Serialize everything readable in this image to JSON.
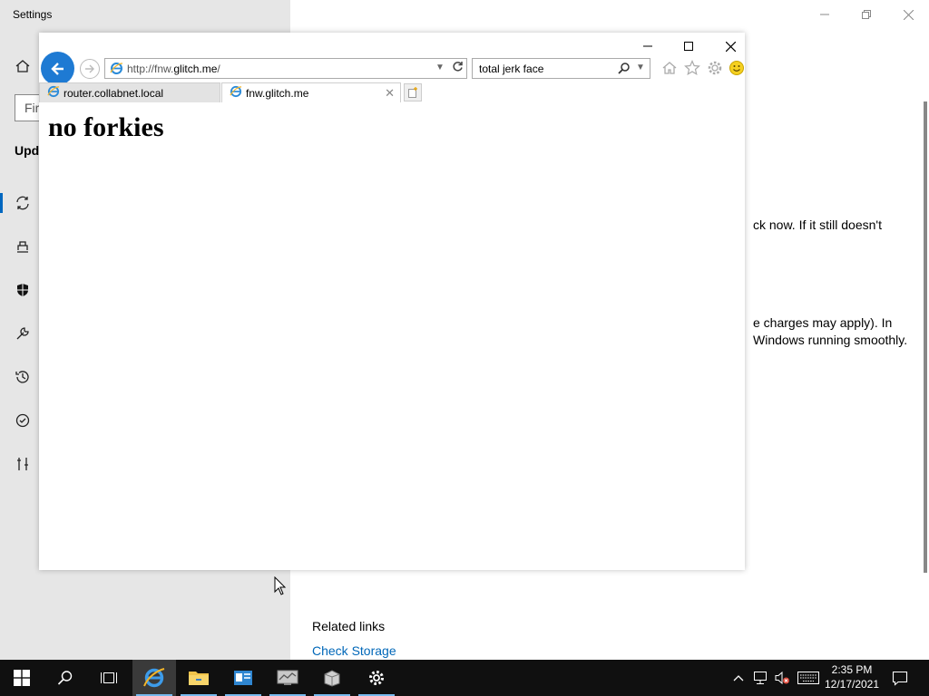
{
  "settings": {
    "title": "Settings",
    "search_placeholder": "Fir",
    "heading": "Upd",
    "body_line_1": "ck now. If it still doesn't",
    "body_line_2": "e charges may apply). In",
    "body_line_3": "Windows running smoothly.",
    "related_links": "Related links",
    "check_storage": "Check Storage"
  },
  "ie": {
    "address_prefix": "http://fnw.",
    "address_domain": "glitch.me",
    "address_suffix": "/",
    "search_value": "total jerk face",
    "tabs": [
      {
        "label": "router.collabnet.local",
        "active": false
      },
      {
        "label": "fnw.glitch.me",
        "active": true
      }
    ],
    "page_heading": "no forkies"
  },
  "taskbar": {
    "time": "2:35 PM",
    "date": "12/17/2021"
  },
  "colors": {
    "accent": "#0067c0",
    "ie_back": "#1e7ad3",
    "taskbar": "#101010",
    "link": "#0067b8"
  }
}
